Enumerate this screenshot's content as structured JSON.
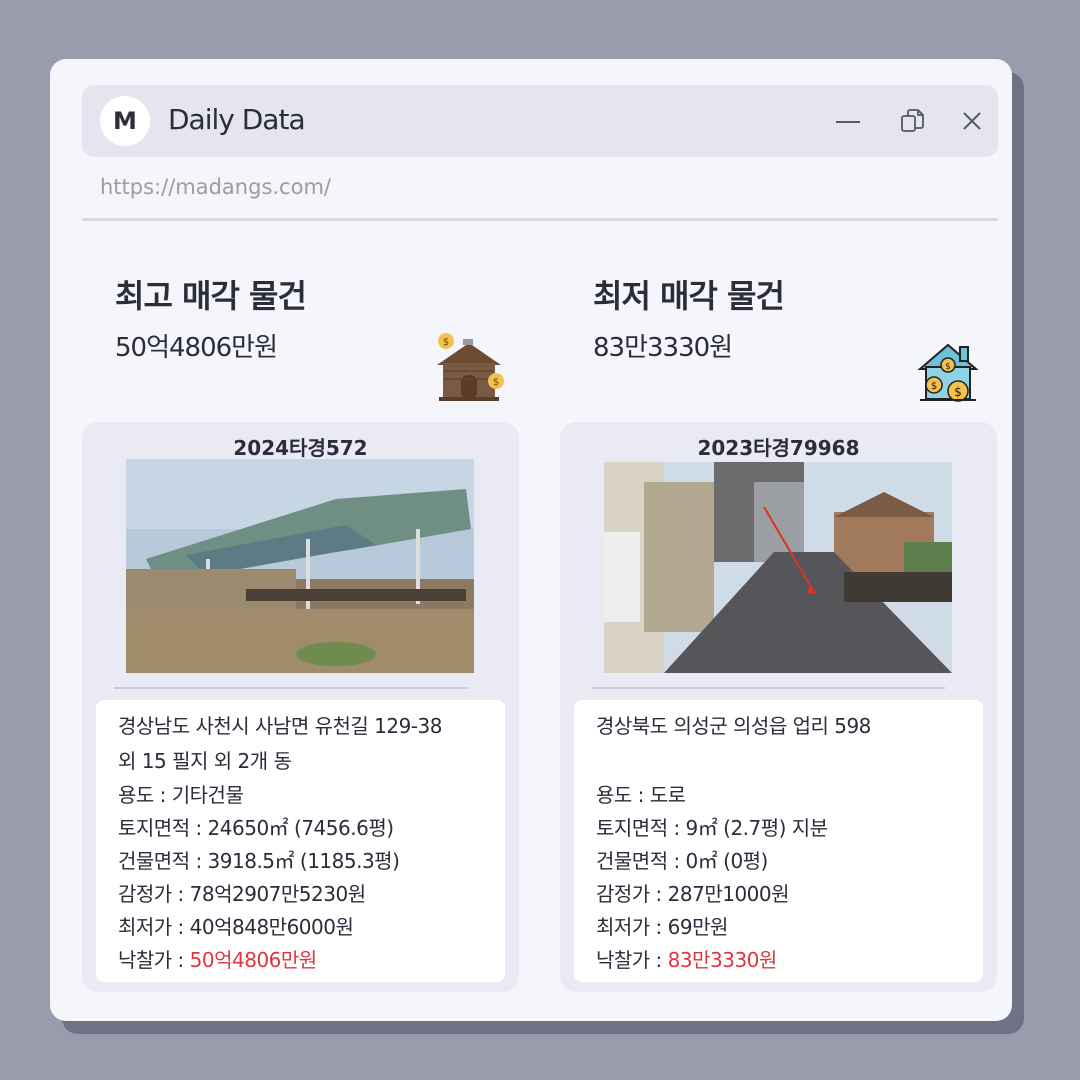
{
  "app": {
    "logo_letter": "M",
    "title": "Daily Data",
    "url": "https://madangs.com/",
    "controls": [
      "minimize-icon",
      "copy-icon",
      "close-icon"
    ]
  },
  "highest": {
    "title": "최고 매각 물건",
    "price": "50억4806만원",
    "icon": "house-money-icon",
    "case_no": "2024타경572",
    "photo_icon": "property-photo",
    "address_line1": "경상남도 사천시 사남면 유천길 129-38",
    "address_line2": "외 15 필지 외 2개 동",
    "usage": "용도 : 기타건물",
    "land_area": "토지면적 : 24650㎡ (7456.6평)",
    "building_area": "건물면적 : 3918.5㎡ (1185.3평)",
    "appraisal": "감정가 : 78억2907만5230원",
    "minimum": "최저가 : 40억848만6000원",
    "winning_label": "낙찰가 : ",
    "winning_value": "50억4806만원"
  },
  "lowest": {
    "title": "최저 매각 물건",
    "price": "83만3330원",
    "icon": "house-coins-icon",
    "case_no": "2023타경79968",
    "photo_icon": "property-photo",
    "address_line1": "경상북도 의성군 의성읍 업리 598",
    "usage": "용도 : 도로",
    "land_area": "토지면적 : 9㎡ (2.7평) 지분",
    "building_area": "건물면적 : 0㎡ (0평)",
    "appraisal": "감정가 :  287만1000원",
    "minimum": "최저가 : 69만원",
    "winning_label": "낙찰가 : ",
    "winning_value": "83만3330원"
  },
  "colors": {
    "background": "#9a9cae",
    "window": "#f5f6fb",
    "accent_red": "#e0363c"
  }
}
